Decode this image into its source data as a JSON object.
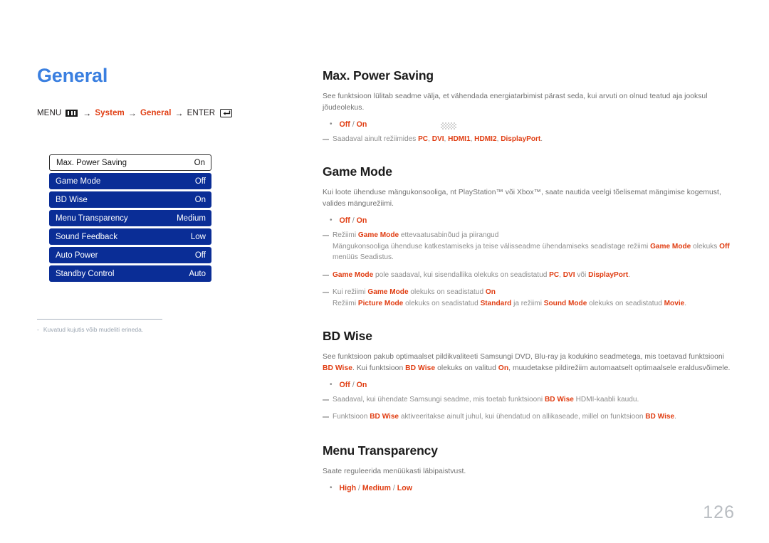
{
  "page": {
    "title": "General",
    "number": "126",
    "title_color": "#3a7fe0",
    "accent_color": "#e03d12",
    "menu_blue": "#0a2d96"
  },
  "breadcrumb": {
    "menu_label": "MENU",
    "menu_icon": "menu-bars-icon",
    "arrow": "→",
    "step1": "System",
    "step2": "General",
    "enter_label": "ENTER",
    "enter_icon": "enter-key-icon"
  },
  "osd_menu": {
    "rows": [
      {
        "label": "Max. Power Saving",
        "value": "On",
        "selected": true
      },
      {
        "label": "Game Mode",
        "value": "Off",
        "selected": false
      },
      {
        "label": "BD Wise",
        "value": "On",
        "selected": false
      },
      {
        "label": "Menu Transparency",
        "value": "Medium",
        "selected": false
      },
      {
        "label": "Sound Feedback",
        "value": "Low",
        "selected": false
      },
      {
        "label": "Auto Power",
        "value": "Off",
        "selected": false
      },
      {
        "label": "Standby Control",
        "value": "Auto",
        "selected": false
      }
    ]
  },
  "left_footnote": {
    "dash": "-",
    "text": "Kuvatud kujutis võib mudeliti erineda."
  },
  "sections": {
    "max_power_saving": {
      "title": "Max. Power Saving",
      "body": "See funktsioon lülitab seadme välja, et vähendada energiatarbimist pärast seda, kui arvuti on olnud teatud aja jooksul jõudeolekus.",
      "options": "Off / On",
      "note": "Saadaval ainult režiimides PC, DVI, HDMI1, HDMI2, DisplayPort."
    },
    "game_mode": {
      "title": "Game Mode",
      "body": "Kui loote ühenduse mängukonsooliga, nt PlayStation™ või Xbox™, saate nautida veelgi tõelisemat mängimise kogemust, valides mängurežiimi.",
      "options": "Off / On",
      "note1_title": "Režiimi Game Mode ettevaatusabinõud ja piirangud",
      "note1_sub": "Mängukonsooliga ühenduse katkestamiseks ja teise välisseadme ühendamiseks seadistage režiimi Game Mode olekuks Off menüüs Seadistus.",
      "note2": "Game Mode pole saadaval, kui sisendallika olekuks on seadistatud PC, DVI või DisplayPort.",
      "note3_title": "Kui režiimi Game Mode olekuks on seadistatud On",
      "note3_sub": "Režiimi Picture Mode olekuks on seadistatud Standard ja režiimi Sound Mode olekuks on seadistatud Movie."
    },
    "bd_wise": {
      "title": "BD Wise",
      "body": "See funktsioon pakub optimaalset pildikvaliteeti Samsungi DVD, Blu-ray ja kodukino seadmetega, mis toetavad funktsiooni BD Wise. Kui funktsioon BD Wise olekuks on valitud On, muudetakse pildirežiim automaatselt optimaalsele eraldusvõimele.",
      "options": "Off / On",
      "note1": "Saadaval, kui ühendate Samsungi seadme, mis toetab funktsiooni BD Wise HDMI-kaabli kaudu.",
      "note2": "Funktsioon BD Wise aktiveeritakse ainult juhul, kui ühendatud on allikaseade, millel on funktsioon BD Wise."
    },
    "menu_transparency": {
      "title": "Menu Transparency",
      "body": "Saate reguleerida menüükasti läbipaistvust.",
      "options": "High / Medium / Low"
    }
  }
}
